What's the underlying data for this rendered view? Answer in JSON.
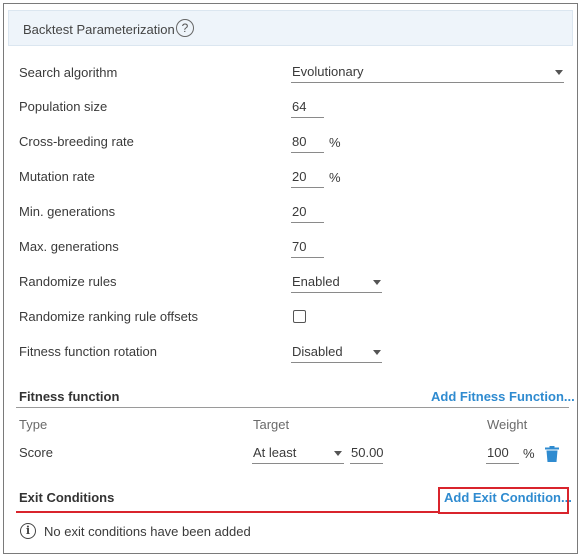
{
  "header": {
    "title": "Backtest Parameterization",
    "help_glyph": "?"
  },
  "params": {
    "search_algorithm": {
      "label": "Search algorithm",
      "value": "Evolutionary"
    },
    "population_size": {
      "label": "Population size",
      "value": "64"
    },
    "cross_breeding_rate": {
      "label": "Cross-breeding rate",
      "value": "80",
      "unit": "%"
    },
    "mutation_rate": {
      "label": "Mutation rate",
      "value": "20",
      "unit": "%"
    },
    "min_generations": {
      "label": "Min. generations",
      "value": "20"
    },
    "max_generations": {
      "label": "Max. generations",
      "value": "70"
    },
    "randomize_rules": {
      "label": "Randomize rules",
      "value": "Enabled"
    },
    "randomize_offsets": {
      "label": "Randomize ranking rule offsets",
      "checked": false
    },
    "fitness_rotation": {
      "label": "Fitness function rotation",
      "value": "Disabled"
    }
  },
  "fitness": {
    "title": "Fitness function",
    "add_link": "Add Fitness Function...",
    "columns": {
      "type": "Type",
      "target": "Target",
      "weight": "Weight"
    },
    "rows": [
      {
        "type": "Score",
        "target_mode": "At least",
        "target_value": "50.00",
        "weight": "100",
        "weight_unit": "%",
        "delete_icon": "trash-icon"
      }
    ]
  },
  "exit_conditions": {
    "title": "Exit Conditions",
    "add_link": "Add Exit Condition...",
    "empty_message": "No exit conditions have been added",
    "info_glyph": "i"
  },
  "colors": {
    "link": "#2f8bd0",
    "highlight": "#d9242c",
    "trash": "#2f8bd0",
    "header_bg": "#eef4fa"
  }
}
